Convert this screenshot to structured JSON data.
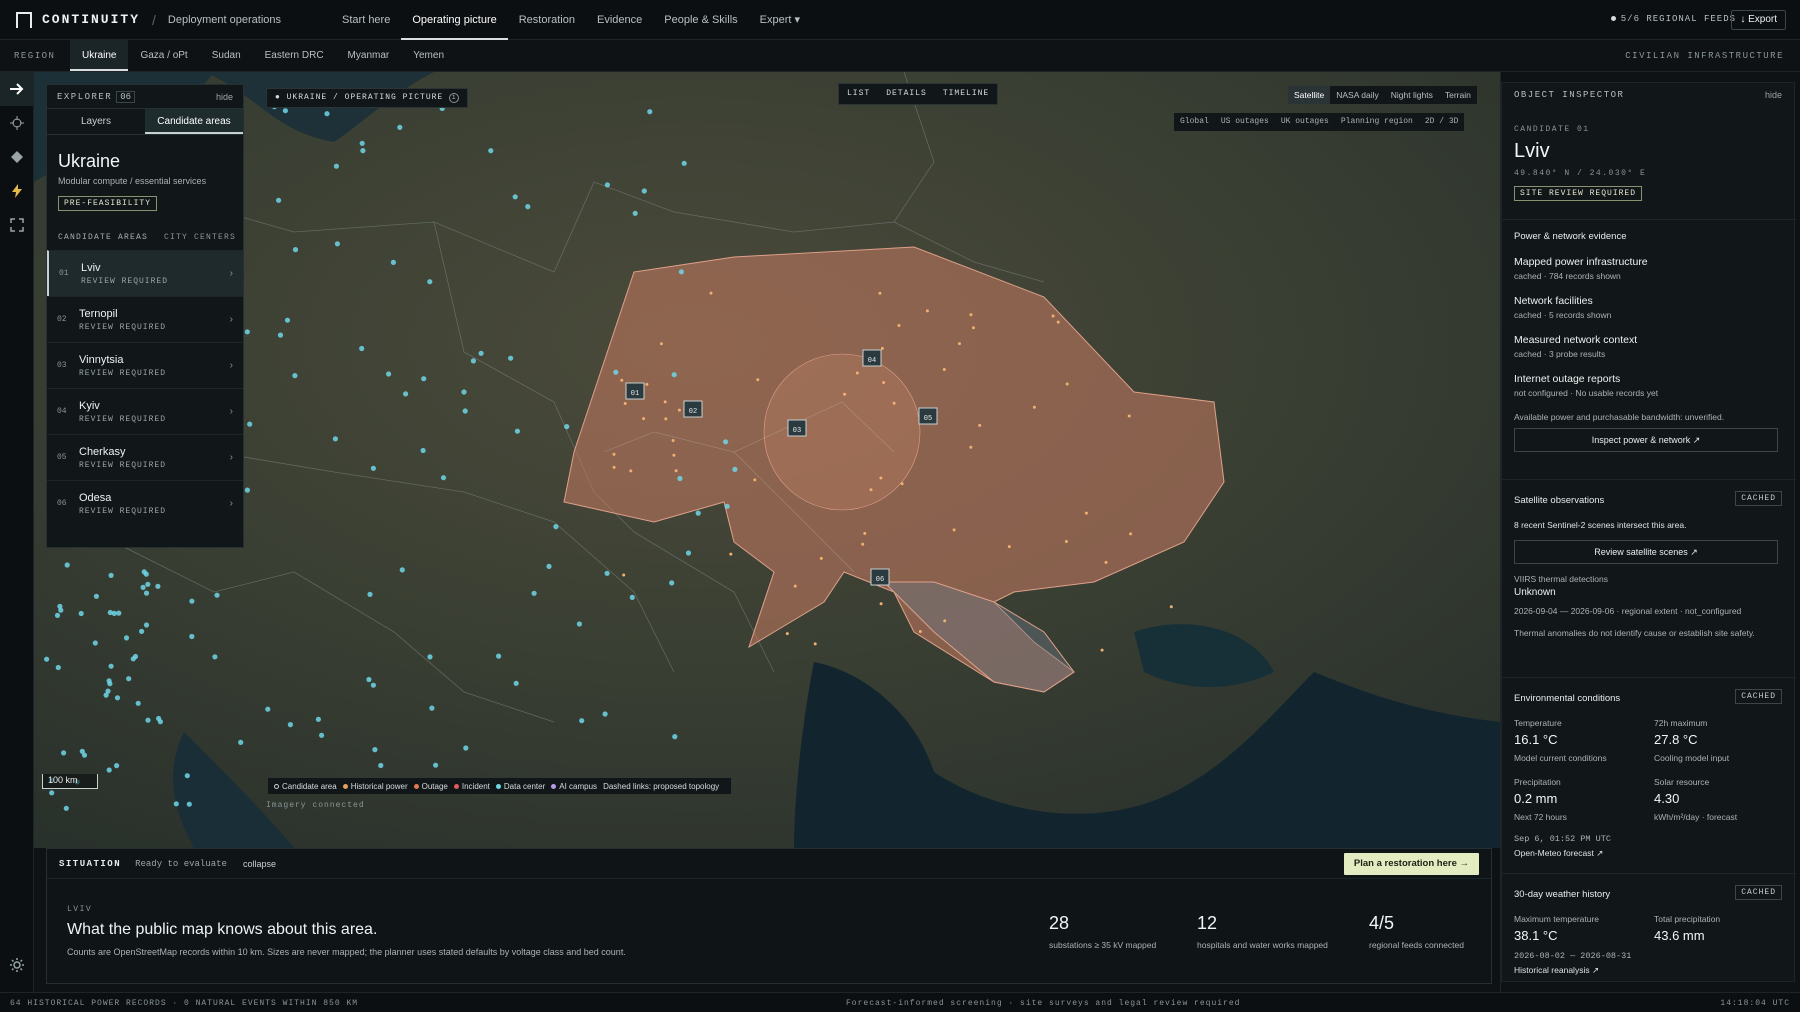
{
  "app": {
    "brand": "CONTINUITY",
    "separator": "/",
    "workspace": "Deployment operations",
    "feeds_status": "5/6 REGIONAL FEEDS",
    "export_label": "↓ Export"
  },
  "nav": [
    "Start here",
    "Operating picture",
    "Restoration",
    "Evidence",
    "People & Skills",
    "Expert ▾"
  ],
  "nav_active": "Operating picture",
  "region_bar": {
    "label": "REGION",
    "tabs": [
      "Ukraine",
      "Gaza / oPt",
      "Sudan",
      "Eastern DRC",
      "Myanmar",
      "Yemen"
    ],
    "active": "Ukraine",
    "right_label": "CIVILIAN INFRASTRUCTURE"
  },
  "rail_icons": [
    "arrow-right-icon",
    "crosshair-icon",
    "diamond-icon",
    "bolt-icon",
    "expand-icon",
    "gear-icon"
  ],
  "explorer": {
    "title": "EXPLORER",
    "count": "06",
    "hide": "hide",
    "tabs": [
      "Layers",
      "Candidate areas"
    ],
    "active_tab": "Candidate areas",
    "region_name": "Ukraine",
    "region_sub": "Modular compute / essential services",
    "badge": "PRE-FEASIBILITY",
    "list_head": [
      "CANDIDATE AREAS",
      "CITY CENTERS"
    ],
    "candidates": [
      {
        "num": "01",
        "name": "Lviv",
        "status": "REVIEW REQUIRED"
      },
      {
        "num": "02",
        "name": "Ternopil",
        "status": "REVIEW REQUIRED"
      },
      {
        "num": "03",
        "name": "Vinnytsia",
        "status": "REVIEW REQUIRED"
      },
      {
        "num": "04",
        "name": "Kyiv",
        "status": "REVIEW REQUIRED"
      },
      {
        "num": "05",
        "name": "Cherkasy",
        "status": "REVIEW REQUIRED"
      },
      {
        "num": "06",
        "name": "Odesa",
        "status": "REVIEW REQUIRED"
      }
    ]
  },
  "map": {
    "breadcrumb": "● UKRAINE / OPERATING PICTURE",
    "info_glyph": "i",
    "view_tabs": [
      "LIST",
      "DETAILS",
      "TIMELINE"
    ],
    "basemaps": [
      "Satellite",
      "NASA daily",
      "Night lights",
      "Terrain"
    ],
    "basemap_active": "Satellite",
    "overlays": [
      "Global",
      "US outages",
      "UK outages",
      "Planning region",
      "2D / 3D"
    ],
    "scale": "100 km",
    "legend": [
      {
        "label": "Candidate area",
        "color": "#c9d0d0"
      },
      {
        "label": "Historical power",
        "color": "#e0a060"
      },
      {
        "label": "Outage",
        "color": "#e07a50"
      },
      {
        "label": "Incident",
        "color": "#e05a5a"
      },
      {
        "label": "Data center",
        "color": "#6fd6e8"
      },
      {
        "label": "AI campus",
        "color": "#b79be8"
      }
    ],
    "legend_note": "Dashed links: proposed topology",
    "imagery_status": "Imagery connected",
    "markers": [
      "01",
      "02",
      "03",
      "04",
      "05",
      "06"
    ]
  },
  "situation": {
    "title": "SITUATION",
    "status": "Ready to evaluate",
    "collapse": "collapse",
    "plan_button": "Plan a restoration here →",
    "location": "LVIV",
    "heading": "What the public map knows about this area.",
    "note": "Counts are OpenStreetMap records within 10 km. Sizes are never mapped; the planner uses stated defaults by voltage class and bed count.",
    "stats": [
      {
        "value": "28",
        "label": "substations ≥ 35 kV mapped"
      },
      {
        "value": "12",
        "label": "hospitals and water works mapped"
      },
      {
        "value": "4/5",
        "label": "regional feeds connected"
      }
    ]
  },
  "inspector": {
    "title": "OBJECT INSPECTOR",
    "hide": "hide",
    "kicker": "CANDIDATE 01",
    "name": "Lviv",
    "coords": "49.840° N / 24.030° E",
    "badge": "SITE REVIEW REQUIRED",
    "power_section": "Power & network evidence",
    "evidence": [
      {
        "title": "Mapped power infrastructure",
        "sub": "cached · 784 records shown"
      },
      {
        "title": "Network facilities",
        "sub": "cached · 5 records shown"
      },
      {
        "title": "Measured network context",
        "sub": "cached · 3 probe results"
      },
      {
        "title": "Internet outage reports",
        "sub": "not configured · No usable records yet"
      }
    ],
    "bandwidth_note": "Available power and purchasable bandwidth: unverified.",
    "inspect_button": "Inspect power & network ↗",
    "satellite": {
      "title": "Satellite observations",
      "cached": "CACHED",
      "text": "8 recent Sentinel-2 scenes intersect this area.",
      "button": "Review satellite scenes ↗",
      "viirs_label": "VIIRS thermal detections",
      "viirs_value": "Unknown",
      "viirs_range": "2026-09-04 — 2026-09-06 · regional extent · not_configured",
      "disclaimer": "Thermal anomalies do not identify cause or establish site safety."
    },
    "environment": {
      "title": "Environmental conditions",
      "cached": "CACHED",
      "cells": [
        {
          "label": "Temperature",
          "value": "16.1 °C",
          "sub": "Model current conditions"
        },
        {
          "label": "72h maximum",
          "value": "27.8 °C",
          "sub": "Cooling model input"
        },
        {
          "label": "Precipitation",
          "value": "0.2 mm",
          "sub": "Next 72 hours"
        },
        {
          "label": "Solar resource",
          "value": "4.30",
          "sub": "kWh/m²/day · forecast"
        }
      ],
      "timestamp": "Sep 6, 01:52 PM UTC",
      "source": "Open-Meteo forecast ↗"
    },
    "history": {
      "title": "30-day weather history",
      "cached": "CACHED",
      "cells": [
        {
          "label": "Maximum temperature",
          "value": "38.1 °C"
        },
        {
          "label": "Total precipitation",
          "value": "43.6 mm"
        }
      ],
      "range": "2026-08-02 — 2026-08-31",
      "source": "Historical reanalysis ↗"
    }
  },
  "footer": {
    "left": "64 HISTORICAL POWER RECORDS · 0 NATURAL EVENTS WITHIN 850 KM",
    "center": "Forecast-informed screening · site surveys and legal review required",
    "right": "14:18:04 UTC"
  }
}
